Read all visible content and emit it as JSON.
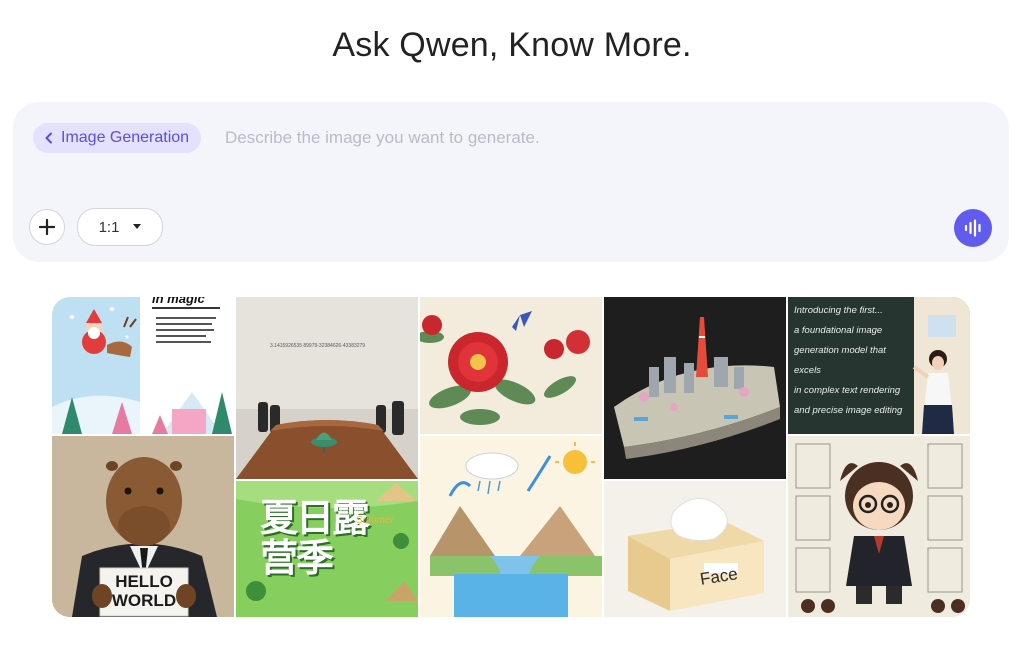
{
  "header": {
    "title": "Ask Qwen, Know More."
  },
  "composer": {
    "mode_label": "Image Generation",
    "prompt_placeholder": "Describe the image you want to generate.",
    "prompt_value": "",
    "aspect_ratio": "1:1"
  },
  "gallery": {
    "items": [
      {
        "name": "santa-storybook",
        "caption": "in magic"
      },
      {
        "name": "conference-table-spinning-top",
        "caption": "3.1415926535 89979-32384626-43383279"
      },
      {
        "name": "peony-butterfly-painting"
      },
      {
        "name": "miniature-city-tower"
      },
      {
        "name": "classroom-chalkboard",
        "caption": "Introducing the first...\na foundational image\ngeneration model that excels\nin complex text rendering\nand precise image editing"
      },
      {
        "name": "capybara-hello-world",
        "caption": "HELLO\nWORLD"
      },
      {
        "name": "summer-camping-lettering",
        "caption": "夏日露营季",
        "sub": "Summer"
      },
      {
        "name": "water-cycle-illustration"
      },
      {
        "name": "tissue-box",
        "caption": "Face"
      },
      {
        "name": "chibi-wizard-character-sheet"
      }
    ]
  },
  "colors": {
    "accent": "#615ced",
    "chip_bg": "#e3e1fc",
    "chip_text": "#5b4ee6",
    "composer_bg": "#f4f5fa"
  }
}
